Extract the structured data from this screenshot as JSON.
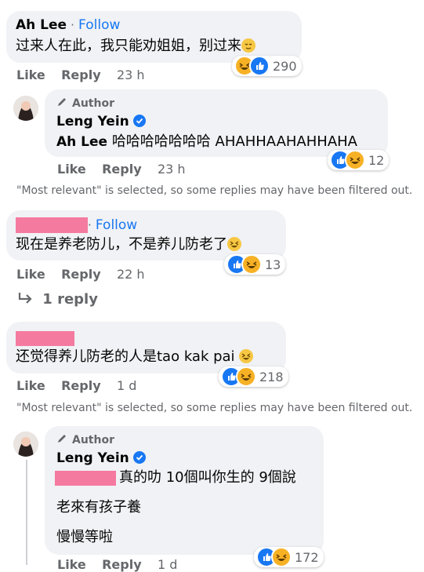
{
  "comments": [
    {
      "author": "Ah Lee",
      "follow": "Follow",
      "dot": "·",
      "text": "过来人在此，我只能劝姐姐，别过来",
      "reactions": "290",
      "like": "Like",
      "reply": "Reply",
      "time": "23 h"
    },
    {
      "badge": "Author",
      "author": "Leng Yein",
      "mention": "Ah Lee",
      "text": "哈哈哈哈哈哈哈 AHAHHAAHAHHAHA",
      "reactions": "12",
      "like": "Like",
      "reply": "Reply",
      "time": "23 h"
    },
    {
      "follow": "Follow",
      "dot": "·",
      "text": "现在是养老防儿，不是养儿防老了",
      "reactions": "13",
      "like": "Like",
      "reply": "Reply",
      "time": "22 h",
      "replies": "1 reply"
    },
    {
      "text": "还觉得养儿防老的人是tao kak pai",
      "reactions": "218",
      "like": "Like",
      "reply": "Reply",
      "time": "1 d"
    },
    {
      "badge": "Author",
      "author": "Leng Yein",
      "line1": "真的叻 10個叫你生的 9個說",
      "line2": "老來有孩子養",
      "line3": "慢慢等啦",
      "reactions": "172",
      "like": "Like",
      "reply": "Reply",
      "time": "1 d"
    }
  ],
  "filter_note": "\"Most relevant\" is selected, so some replies may have been filtered out.",
  "colors": {
    "link": "#1877f2",
    "bubble": "#f0f2f5",
    "muted": "#65676b",
    "redaction": "#f57aa0"
  }
}
